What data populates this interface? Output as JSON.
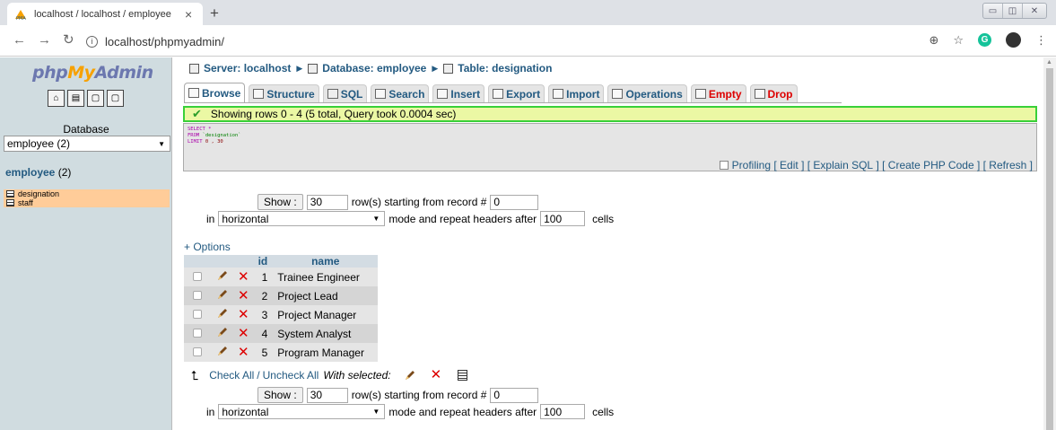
{
  "browser": {
    "tab_title": "localhost / localhost / employee",
    "new_tab": "+",
    "url": "localhost/phpmyadmin/",
    "colors": {
      "chrome": "#dee1e6"
    }
  },
  "nav": {
    "logo": {
      "php": "php",
      "my": "My",
      "admin": "Admin"
    },
    "database_label": "Database",
    "database_select": "employee (2)",
    "db_heading_name": "employee",
    "db_heading_count": "(2)",
    "tables": [
      {
        "name": "designation"
      },
      {
        "name": "staff"
      }
    ]
  },
  "breadcrumb": {
    "server": "Server: localhost",
    "database": "Database: employee",
    "table": "Table: designation"
  },
  "tabs": [
    {
      "label": "Browse",
      "icon": "browse-icon"
    },
    {
      "label": "Structure",
      "icon": "structure-icon"
    },
    {
      "label": "SQL",
      "icon": "sql-icon"
    },
    {
      "label": "Search",
      "icon": "search-icon"
    },
    {
      "label": "Insert",
      "icon": "insert-icon"
    },
    {
      "label": "Export",
      "icon": "export-icon"
    },
    {
      "label": "Import",
      "icon": "import-icon"
    },
    {
      "label": "Operations",
      "icon": "operations-icon"
    },
    {
      "label": "Empty",
      "icon": "empty-icon"
    },
    {
      "label": "Drop",
      "icon": "drop-icon"
    }
  ],
  "status": {
    "message": "Showing rows 0 - 4 (5 total, Query took 0.0004 sec)",
    "color": "#39d039"
  },
  "sql": {
    "line1": "SELECT *",
    "line2_kw": "FROM",
    "line2_val": "`designation`",
    "line3_kw": "LIMIT",
    "line3_val": "0 , 30"
  },
  "sql_links": {
    "profiling": "Profiling",
    "edit": "Edit",
    "explain": "Explain SQL",
    "php": "Create PHP Code",
    "refresh": "Refresh"
  },
  "pager": {
    "show_button": "Show :",
    "rows_value": "30",
    "starting_text": "row(s) starting from record #",
    "start_value": "0",
    "in_text": "in",
    "mode_value": "horizontal",
    "mode_text": "mode and repeat headers after",
    "repeat_value": "100",
    "cells_text": "cells"
  },
  "options_link": "+ Options",
  "table": {
    "columns": [
      "id",
      "name"
    ],
    "rows": [
      {
        "id": "1",
        "name": "Trainee Engineer"
      },
      {
        "id": "2",
        "name": "Project Lead"
      },
      {
        "id": "3",
        "name": "Project Manager"
      },
      {
        "id": "4",
        "name": "System Analyst"
      },
      {
        "id": "5",
        "name": "Program Manager"
      }
    ]
  },
  "bulk": {
    "check_all": "Check All",
    "separator": "/",
    "uncheck_all": "Uncheck All",
    "with_selected": "With selected:"
  }
}
